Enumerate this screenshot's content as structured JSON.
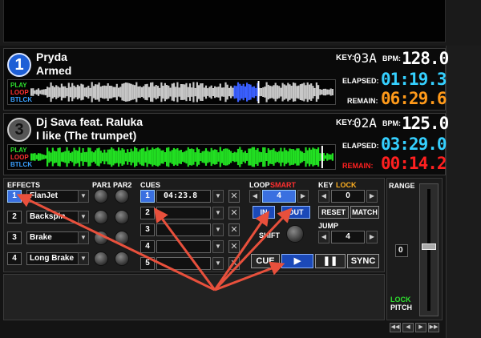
{
  "deck1": {
    "number": "1",
    "artist": "Pryda",
    "title": "Armed",
    "key_label": "KEY:",
    "key": "03A",
    "bpm_label": "BPM:",
    "bpm": "128.0",
    "elapsed_label": "ELAPSED:",
    "elapsed": "01:19.3",
    "remain_label": "REMAIN:",
    "remain": "06:29.6",
    "progress": 0.75,
    "waveform_color": "#c8c8c8",
    "played_color": "#3a5fff"
  },
  "deck2": {
    "number": "3",
    "artist": "Dj Sava feat. Raluka",
    "title": "I like (The trumpet)",
    "key_label": "KEY:",
    "key": "02A",
    "bpm_label": "BPM:",
    "bpm": "125.0",
    "elapsed_label": "ELAPSED:",
    "elapsed": "03:29.0",
    "remain_label": "REMAIN:",
    "remain": "00:14.2",
    "progress": 0.96,
    "waveform_color": "#22e022"
  },
  "wave_labels": {
    "play": "PLAY",
    "loop": "LOOP",
    "btlck": "BTLCK"
  },
  "effects": {
    "label": "EFFECTS",
    "par1": "PAR1",
    "par2": "PAR2",
    "slots": [
      {
        "num": "1",
        "name": "FlanJet",
        "active": true
      },
      {
        "num": "2",
        "name": "Backspin",
        "active": false
      },
      {
        "num": "3",
        "name": "Brake",
        "active": false
      },
      {
        "num": "4",
        "name": "Long Brake",
        "active": false
      }
    ]
  },
  "cues": {
    "label": "CUES",
    "items": [
      {
        "num": "1",
        "time": "04:23.8",
        "active": true
      },
      {
        "num": "2",
        "time": "",
        "active": false
      },
      {
        "num": "3",
        "time": "",
        "active": false
      },
      {
        "num": "4",
        "time": "",
        "active": false
      },
      {
        "num": "5",
        "time": "",
        "active": false
      }
    ]
  },
  "loop": {
    "label": "LOOP",
    "smart": "SMART",
    "value": "4",
    "in": "IN",
    "out": "OUT",
    "shift": "SHIFT"
  },
  "key": {
    "label": "KEY",
    "lock": "LOCK",
    "value": "0",
    "reset": "RESET",
    "match": "MATCH",
    "jump_label": "JUMP",
    "jump_value": "4"
  },
  "transport": {
    "cue": "CUE",
    "play": "▶",
    "pause": "❚❚",
    "sync": "SYNC"
  },
  "pitch": {
    "range_label": "RANGE",
    "value": "0",
    "lock": "LOCK",
    "pitch": "PITCH"
  },
  "colors": {
    "cyan": "#35d0ff",
    "orange": "#ff9a1a",
    "red": "#ff2020",
    "accent_blue": "#3a70e0",
    "annotation_arrow": "#e8503c"
  }
}
